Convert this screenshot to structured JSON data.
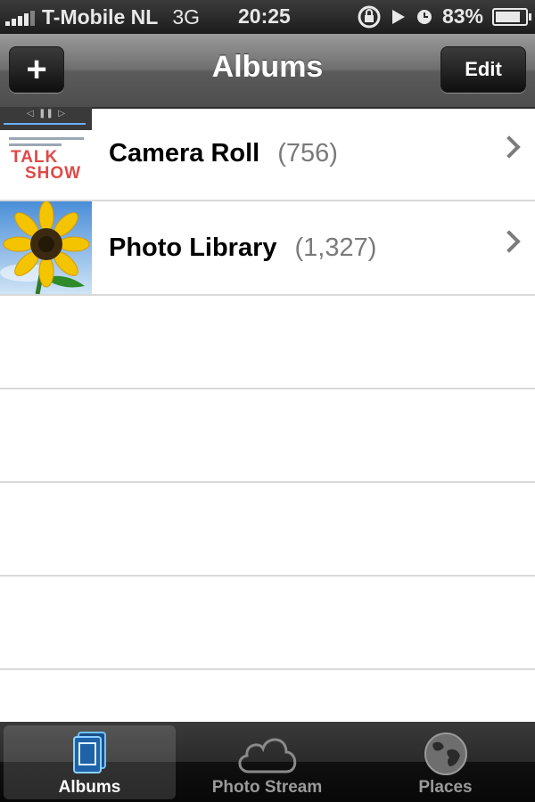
{
  "status": {
    "carrier": "T-Mobile NL",
    "network": "3G",
    "time": "20:25",
    "battery": "83%",
    "battery_level": 0.83
  },
  "nav": {
    "title": "Albums",
    "add_label": "+",
    "edit_label": "Edit"
  },
  "albums": [
    {
      "name": "Camera Roll",
      "count": "(756)",
      "thumbnail_text": [
        "TALK",
        "SHOW"
      ]
    },
    {
      "name": "Photo Library",
      "count": "(1,327)"
    }
  ],
  "tabs": [
    {
      "label": "Albums",
      "icon": "albums-icon",
      "active": true
    },
    {
      "label": "Photo Stream",
      "icon": "cloud-icon",
      "active": false
    },
    {
      "label": "Places",
      "icon": "globe-icon",
      "active": false
    }
  ],
  "colors": {
    "accent": "#5ab0ff",
    "count_gray": "#7a7a7a"
  }
}
